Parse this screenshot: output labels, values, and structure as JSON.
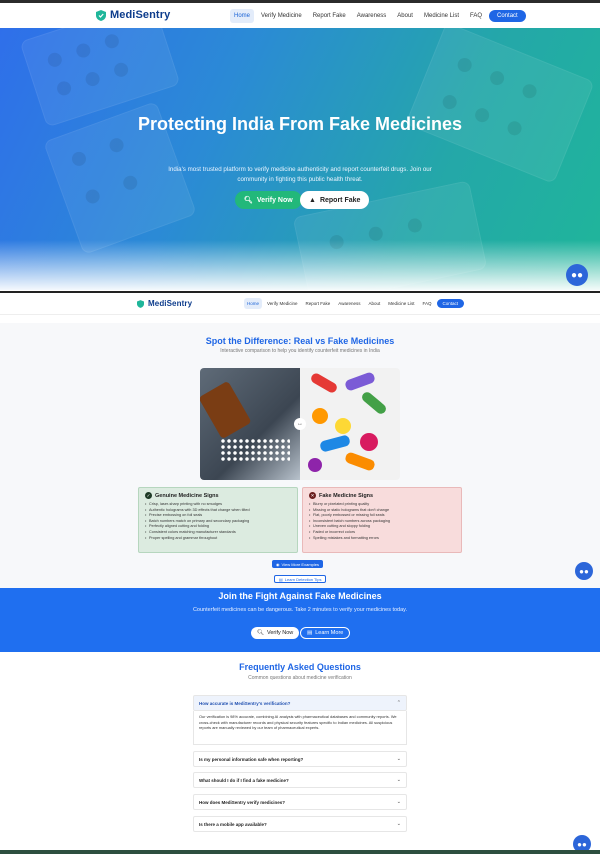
{
  "nav": {
    "brand": "MediSentry",
    "links": [
      "Home",
      "Verify Medicine",
      "Report Fake",
      "Awareness",
      "About",
      "Medicine List",
      "FAQ"
    ],
    "contact": "Contact"
  },
  "hero": {
    "title": "Protecting India From Fake Medicines",
    "subtitle": "India's most trusted platform to verify medicine authenticity and report counterfeit drugs. Join our community in fighting this public health threat.",
    "verify_btn": "Verify Now",
    "report_btn": "Report Fake"
  },
  "compare": {
    "title": "Spot the Difference: Real vs Fake Medicines",
    "subtitle": "Interactive comparison to help you identify counterfeit medicines in India",
    "slider_icon": "↔",
    "genuine": {
      "title": "Genuine Medicine Signs",
      "items": [
        "Crisp, laser-sharp printing with no smudges",
        "Authentic holograms with 3D effects that change when tilted",
        "Precise embossing on foil seals",
        "Batch numbers match on primary and secondary packaging",
        "Perfectly aligned cutting and folding",
        "Consistent colors matching manufacturer standards",
        "Proper spelling and grammar throughout"
      ]
    },
    "fake": {
      "title": "Fake Medicine Signs",
      "items": [
        "Blurry or pixelated printing quality",
        "Missing or static holograms that don't change",
        "Flat, poorly embossed or missing foil seals",
        "Inconsistent batch numbers across packaging",
        "Uneven cutting and sloppy folding",
        "Faded or incorrect colors",
        "Spelling mistakes and formatting errors"
      ]
    },
    "more_btn": "View More Examples",
    "tips_btn": "Learn Detection Tips"
  },
  "join": {
    "title": "Join the Fight Against Fake Medicines",
    "text": "Counterfeit medicines can be dangerous. Take 2 minutes to verify your medicines today.",
    "verify_btn": "Verify Now",
    "learn_btn": "Learn More"
  },
  "faq": {
    "title": "Frequently Asked Questions",
    "subtitle": "Common questions about medicine verification",
    "open_q": "How accurate is MediSentry's verification?",
    "open_a": "Our verification is 98% accurate, combining AI analysis with pharmaceutical databases and community reports. We cross-check with manufacturer records and physical security features specific to Indian medicines. All suspicious reports are manually reviewed by our team of pharmaceutical experts.",
    "questions": [
      "Is my personal information safe when reporting?",
      "What should I do if I find a fake medicine?",
      "How does MediSentry verify medicines?",
      "Is there a mobile app available?"
    ]
  },
  "colors": {
    "brand": "#0d3c8c",
    "accent": "#1f66e5",
    "green": "#22b87a"
  }
}
